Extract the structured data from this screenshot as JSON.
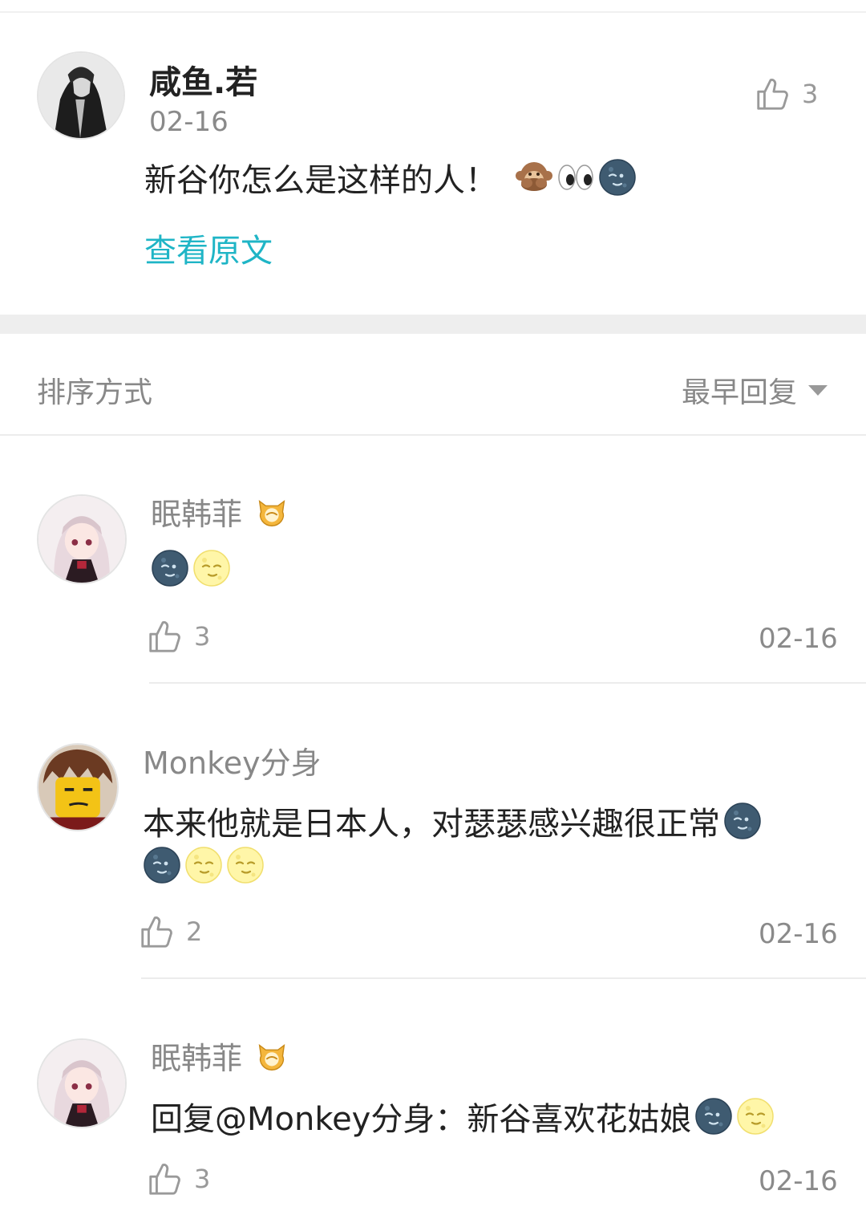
{
  "post": {
    "author": "咸鱼.若",
    "date": "02-16",
    "text": "新谷你怎么是这样的人！",
    "emoji": [
      "monkey-hide-icon",
      "eyes-icon",
      "new-moon-face-icon"
    ],
    "likes": "3",
    "view_original": "查看原文"
  },
  "sort": {
    "label": "排序方式",
    "value": "最早回复"
  },
  "replies": [
    {
      "author": "眠韩菲",
      "text": "",
      "emoji": [
        "new-moon-face-icon",
        "full-moon-face-icon"
      ],
      "likes": "3",
      "date": "02-16"
    },
    {
      "author": "Monkey分身",
      "text": "本来他就是日本人，对瑟瑟感兴趣很正常",
      "emoji_line1": [
        "new-moon-face-icon"
      ],
      "emoji_line2": [
        "new-moon-face-icon",
        "full-moon-face-icon",
        "full-moon-face-icon"
      ],
      "likes": "2",
      "date": "02-16"
    },
    {
      "author": "眠韩菲",
      "text": "回复@Monkey分身：新谷喜欢花姑娘",
      "emoji": [
        "new-moon-face-icon",
        "full-moon-face-icon"
      ],
      "likes": "3",
      "date": "02-16"
    }
  ],
  "colors": {
    "link": "#1fb5c6",
    "muted": "#888888",
    "divider": "#ececec"
  }
}
